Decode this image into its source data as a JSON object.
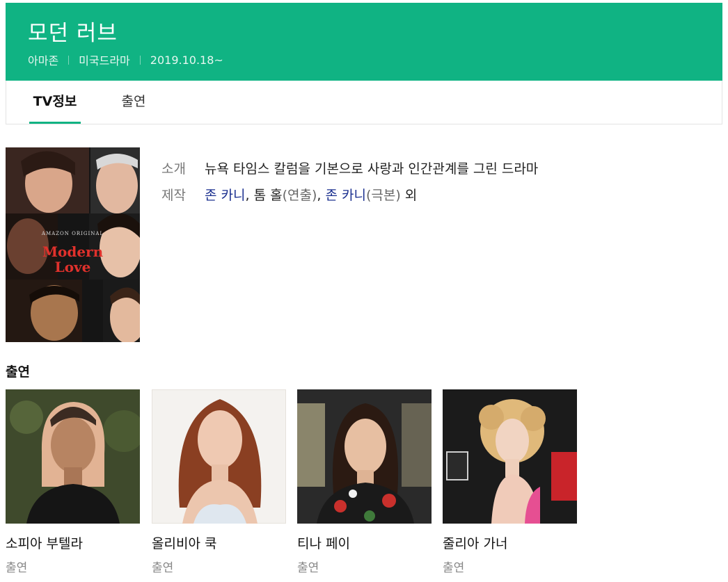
{
  "header": {
    "title": "모던 러브",
    "network": "아마존",
    "genre": "미국드라마",
    "date": "2019.10.18~"
  },
  "tabs": [
    {
      "label": "TV정보",
      "active": true
    },
    {
      "label": "출연",
      "active": false
    }
  ],
  "poster": {
    "brand_text": "AMAZON ORIGINAL",
    "title_line1": "Modern",
    "title_line2": "Love"
  },
  "info": {
    "intro_label": "소개",
    "intro_value": "뉴욕 타임스 칼럼을 기본으로 사랑과 인간관계를 그린 드라마",
    "production_label": "제작",
    "production": {
      "person1": "존 카니",
      "sep1": ", 톰 홀",
      "role1": "(연출)",
      "sep2": ", ",
      "person2": "존 카니",
      "role2": "(극본)",
      "suffix": " 외"
    }
  },
  "cast": {
    "heading": "출연",
    "members": [
      {
        "name": "소피아 부텔라",
        "role": "출연"
      },
      {
        "name": "올리비아 쿡",
        "role": "출연"
      },
      {
        "name": "티나 페이",
        "role": "출연"
      },
      {
        "name": "줄리아 가너",
        "role": "출연"
      }
    ]
  },
  "colors": {
    "accent": "#10b383",
    "link": "#1a2f8f"
  }
}
